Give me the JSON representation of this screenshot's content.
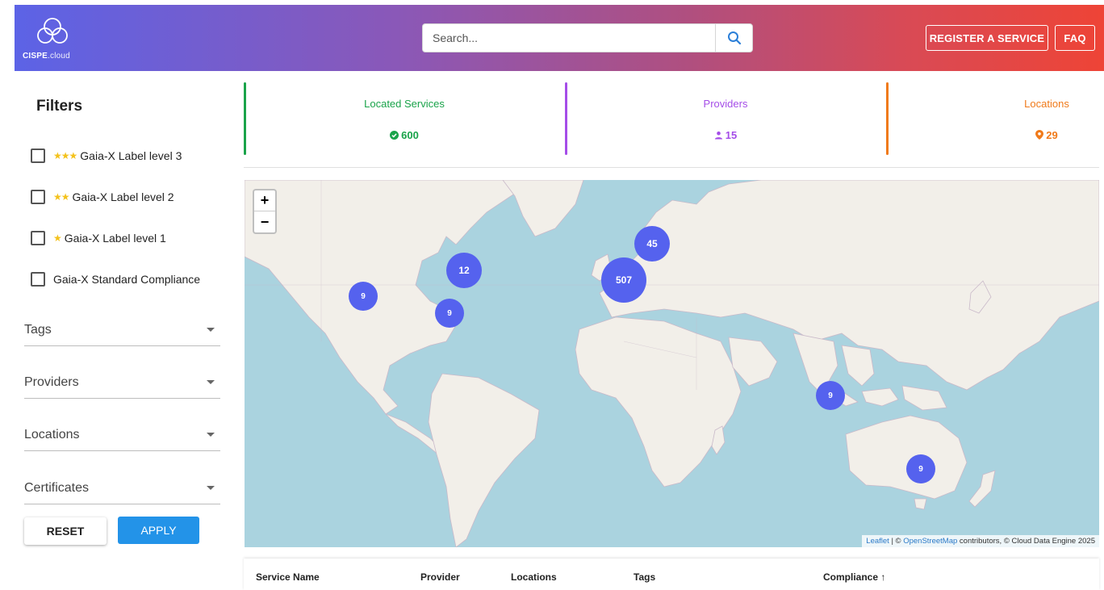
{
  "header": {
    "logo_text": "CISPE",
    "logo_sub": ".cloud",
    "search_placeholder": "Search...",
    "register_label": "REGISTER A SERVICE",
    "faq_label": "FAQ",
    "gradient_colors": [
      "#5c63e6",
      "#ee4436"
    ]
  },
  "sidebar": {
    "title": "Filters",
    "checkboxes": [
      {
        "stars": "★★★",
        "label": "Gaia-X Label level 3",
        "checked": false
      },
      {
        "stars": "★★",
        "label": "Gaia-X Label level 2",
        "checked": false
      },
      {
        "stars": "★",
        "label": "Gaia-X Label level 1",
        "checked": false
      },
      {
        "stars": "",
        "label": "Gaia-X Standard Compliance",
        "checked": false
      }
    ],
    "dropdowns": [
      "Tags",
      "Providers",
      "Locations",
      "Certificates"
    ],
    "reset_label": "RESET",
    "apply_label": "APPLY"
  },
  "stats": [
    {
      "label": "Located Services",
      "value": "600",
      "color": "#1aa34a",
      "icon": "check-circle-icon"
    },
    {
      "label": "Providers",
      "value": "15",
      "color": "#a54de8",
      "icon": "person-icon"
    },
    {
      "label": "Locations",
      "value": "29",
      "color": "#f07a1a",
      "icon": "map-pin-icon"
    }
  ],
  "map": {
    "zoom_in": "+",
    "zoom_out": "−",
    "clusters": [
      "45",
      "12",
      "507",
      "9",
      "9",
      "9",
      "9"
    ],
    "attribution_leaflet": "Leaflet",
    "attribution_osm": "OpenStreetMap",
    "attribution_prefix": " | © ",
    "attribution_suffix": " contributors, © Cloud Data Engine 2025"
  },
  "table": {
    "columns": [
      "Service Name",
      "Provider",
      "Locations",
      "Tags",
      "Compliance ↑"
    ]
  }
}
